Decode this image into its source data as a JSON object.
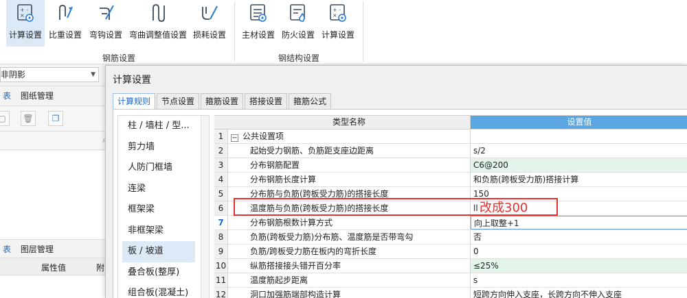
{
  "ribbon": {
    "rebar_buttons": [
      {
        "label": "计算设置",
        "icon": "calc-settings-icon"
      },
      {
        "label": "比重设置",
        "icon": "weight-icon"
      },
      {
        "label": "弯钩设置",
        "icon": "hook-icon"
      },
      {
        "label": "弯曲调整值设置",
        "icon": "bend-adjust-icon"
      },
      {
        "label": "损耗设置",
        "icon": "loss-icon"
      }
    ],
    "rebar_group_label": "钢筋设置",
    "steel_buttons": [
      {
        "label": "主材设置",
        "icon": "main-material-icon"
      },
      {
        "label": "防火设置",
        "icon": "fire-icon"
      },
      {
        "label": "计算设置",
        "icon": "calc-settings-icon"
      }
    ],
    "steel_group_label": "钢结构设置"
  },
  "left_dock": {
    "shadow_dropdown": "非阴影",
    "tab_a_prefix": "表",
    "tab_a_label": "图纸管理",
    "tab_b_prefix": "表",
    "tab_b_label": "图层管理",
    "col_attr": "属性值",
    "col_attach": "附"
  },
  "dialog": {
    "title": "计算设置",
    "tabs": [
      "计算规则",
      "节点设置",
      "箍筋设置",
      "搭接设置",
      "箍筋公式"
    ],
    "categories": [
      "柱 / 墙柱 / 型...",
      "剪力墙",
      "人防门框墙",
      "连梁",
      "框架梁",
      "非框架梁",
      "板 / 坡道",
      "叠合板(整厚)",
      "组合板(混凝土)"
    ],
    "selected_category": "板 / 坡道",
    "grid": {
      "col_name": "类型名称",
      "col_value": "设置值",
      "rows": [
        {
          "num": "1",
          "name": "公共设置项",
          "value": "",
          "group": true
        },
        {
          "num": "2",
          "name": "起始受力钢筋、负筋距支座边距离",
          "value": "s/2"
        },
        {
          "num": "3",
          "name": "分布钢筋配置",
          "value": "C6@200"
        },
        {
          "num": "4",
          "name": "分布钢筋长度计算",
          "value": "和负筋(跨板受力筋)搭接计算"
        },
        {
          "num": "5",
          "name": "分布筋与负筋(跨板受力筋)的搭接长度",
          "value": "150"
        },
        {
          "num": "6",
          "name": "温度筋与负筋(跨板受力筋)的搭接长度",
          "value": "ll"
        },
        {
          "num": "7",
          "name": "分布钢筋根数计算方式",
          "value": "向上取整+1"
        },
        {
          "num": "8",
          "name": "负筋(跨板受力筋)分布筋、温度筋是否带弯勾",
          "value": "否"
        },
        {
          "num": "9",
          "name": "负筋/跨板受力筋在板内的弯折长度",
          "value": "0"
        },
        {
          "num": "10",
          "name": "纵筋搭接接头错开百分率",
          "value": "≤25%"
        },
        {
          "num": "11",
          "name": "温度筋起步距离",
          "value": "s"
        },
        {
          "num": "12",
          "name": "洞口加强筋端部构造计算",
          "value": "短跨方向伸入支座，长跨方向不伸入支座"
        }
      ]
    }
  },
  "annotation": {
    "text": "改成300",
    "color": "#e53030"
  }
}
